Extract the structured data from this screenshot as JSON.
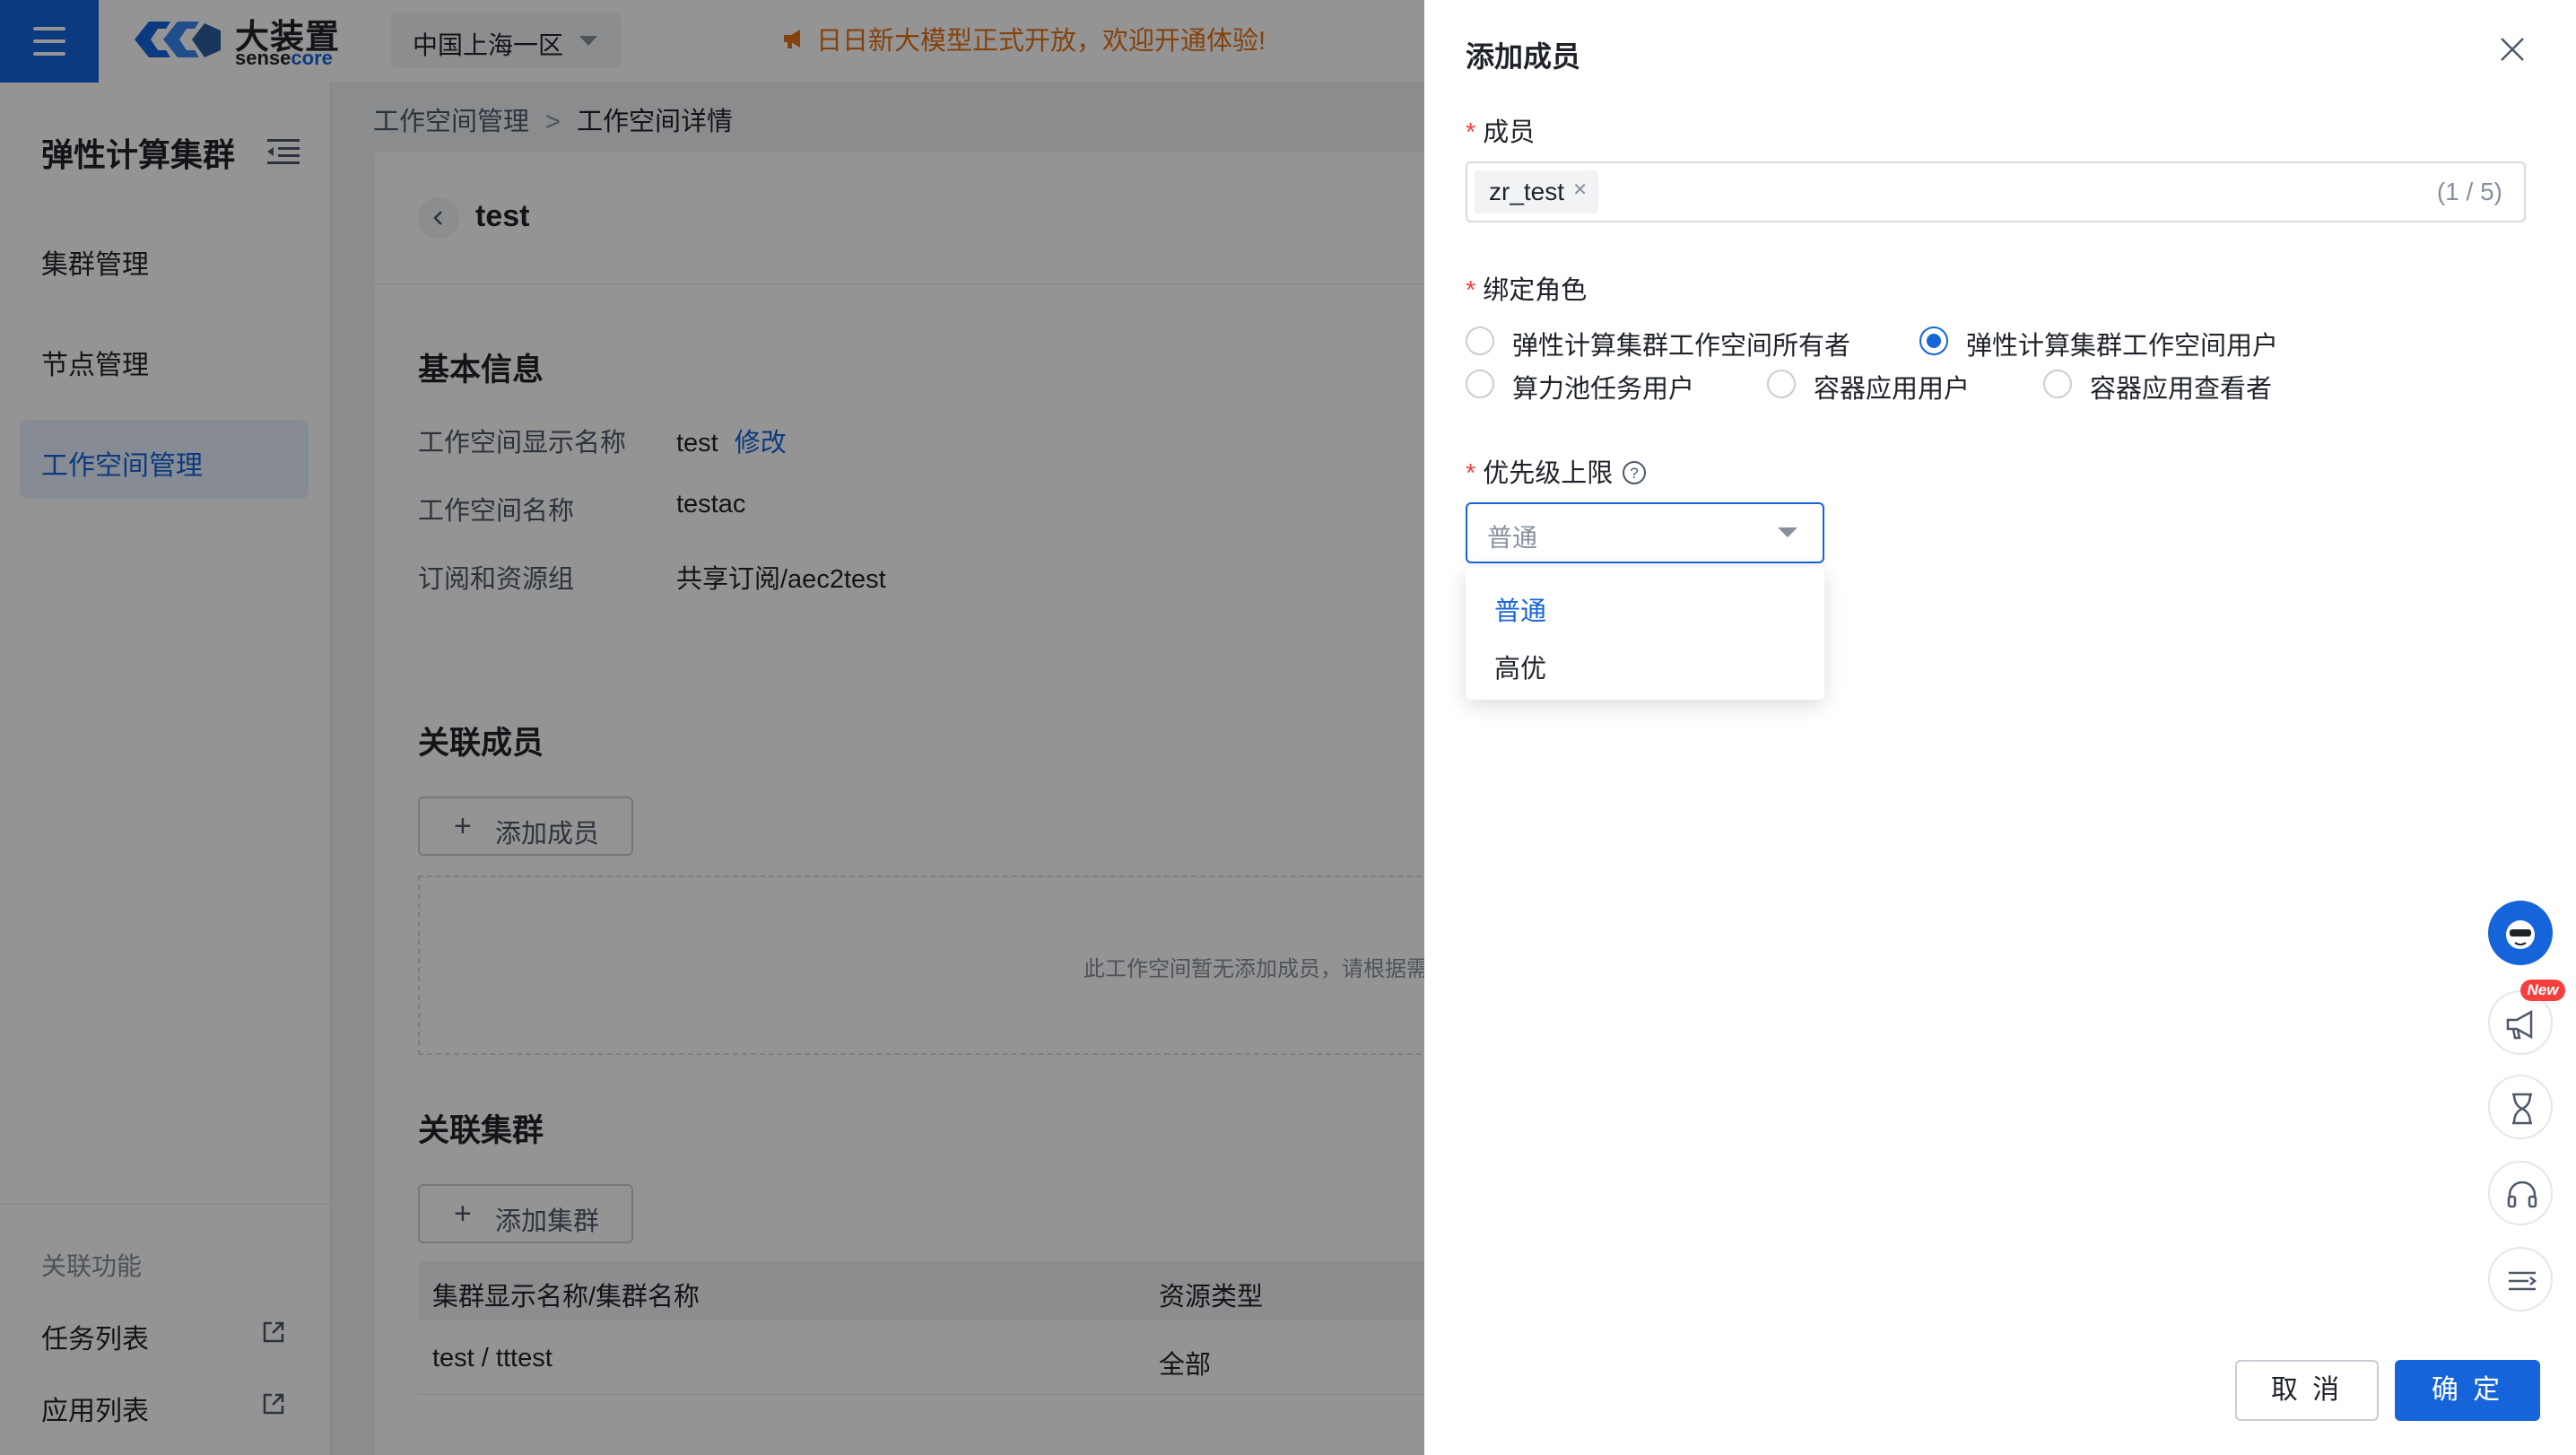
{
  "topbar": {
    "logo_cn": "大装置",
    "logo_en_a": "sense",
    "logo_en_b": "core",
    "region": "中国上海一区",
    "notice": "日日新大模型正式开放，欢迎开通体验!"
  },
  "sidebar": {
    "title": "弹性计算集群",
    "items": [
      {
        "label": "集群管理"
      },
      {
        "label": "节点管理"
      },
      {
        "label": "工作空间管理"
      }
    ],
    "related_title": "关联功能",
    "links": [
      {
        "label": "任务列表"
      },
      {
        "label": "应用列表"
      }
    ]
  },
  "breadcrumb": {
    "parent": "工作空间管理",
    "sep": ">",
    "current": "工作空间详情"
  },
  "detail": {
    "title": "test",
    "basic_title": "基本信息",
    "fields": [
      {
        "label": "工作空间显示名称",
        "value": "test",
        "action": "修改"
      },
      {
        "label": "工作空间名称",
        "value": "testac"
      },
      {
        "label": "订阅和资源组",
        "value": "共享订阅/aec2test"
      }
    ],
    "members_title": "关联成员",
    "add_member": "添加成员",
    "empty_text": "此工作空间暂无添加成员，请根据需",
    "clusters_title": "关联集群",
    "add_cluster": "添加集群",
    "table": {
      "columns": [
        "集群显示名称/集群名称",
        "资源类型"
      ],
      "rows": [
        [
          "test / tttest",
          "全部"
        ]
      ]
    }
  },
  "drawer": {
    "title": "添加成员",
    "member_label": "成员",
    "member_tag": "zr_test",
    "member_count": "(1 / 5)",
    "role_label": "绑定角色",
    "roles": [
      {
        "label": "弹性计算集群工作空间所有者",
        "checked": false
      },
      {
        "label": "弹性计算集群工作空间用户",
        "checked": true
      },
      {
        "label": "算力池任务用户",
        "checked": false
      },
      {
        "label": "容器应用用户",
        "checked": false
      },
      {
        "label": "容器应用查看者",
        "checked": false
      }
    ],
    "priority_label": "优先级上限",
    "priority_value": "普通",
    "priority_options": [
      "普通",
      "高优"
    ],
    "cancel": "取 消",
    "confirm": "确 定",
    "new_badge": "New"
  },
  "colors": {
    "primary": "#1664d9",
    "notice": "#e37318",
    "required": "#f53f3f"
  },
  "icons": [
    "menu-icon",
    "chevron-down-icon",
    "megaphone-icon",
    "list-collapse-icon",
    "external-link-icon",
    "chevron-left-icon",
    "plus-icon",
    "close-icon",
    "question-circle-icon",
    "assistant-avatar-icon",
    "announcement-icon",
    "hourglass-icon",
    "headset-icon",
    "list-indent-icon"
  ]
}
